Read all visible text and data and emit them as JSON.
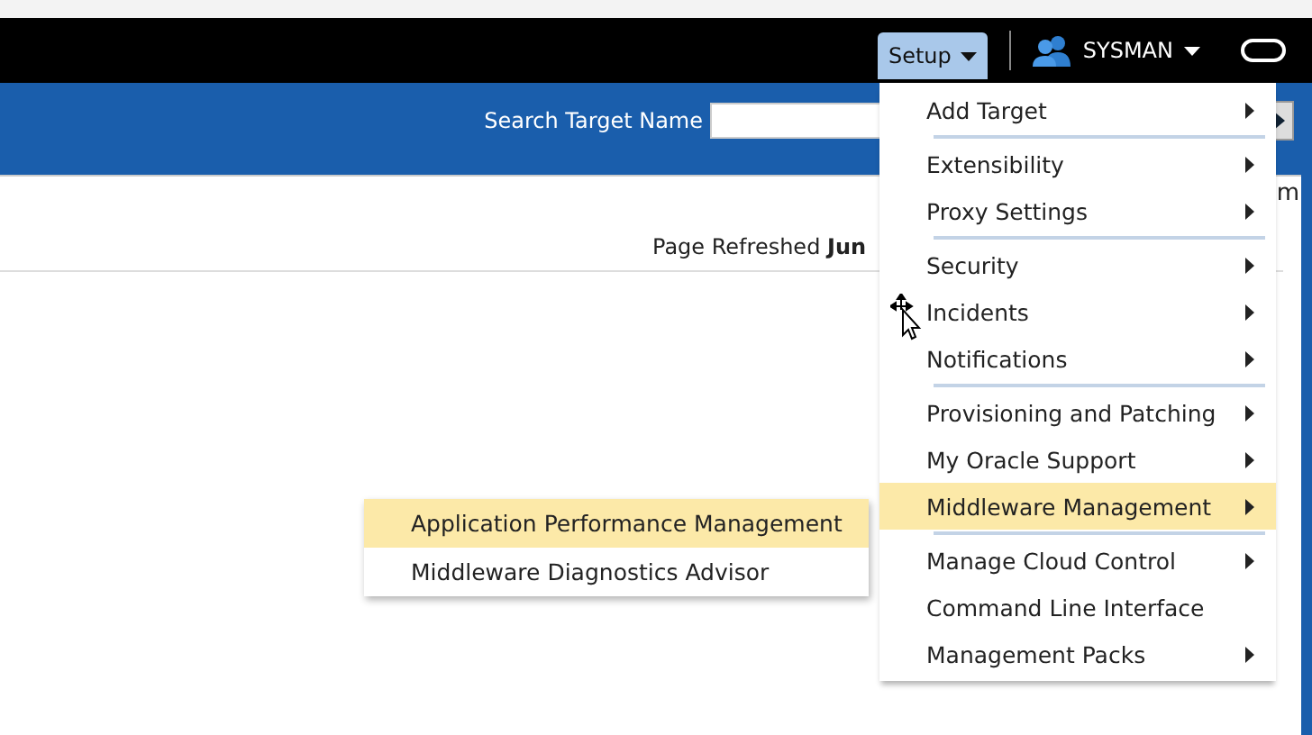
{
  "header": {
    "setup_button": {
      "label": "Setup",
      "expanded": true
    },
    "user_menu": {
      "label": "SYSMAN"
    }
  },
  "search": {
    "label": "Search Target Name"
  },
  "page": {
    "refreshed_label": "Page Refreshed",
    "refreshed_value": "Jun",
    "fragment": "m"
  },
  "setup_menu": {
    "groups": [
      [
        {
          "label": "Add Target",
          "submenu": true,
          "selected": false
        }
      ],
      [
        {
          "label": "Extensibility",
          "submenu": true,
          "selected": false
        },
        {
          "label": "Proxy Settings",
          "submenu": true,
          "selected": false
        }
      ],
      [
        {
          "label": "Security",
          "submenu": true,
          "selected": false
        },
        {
          "label": "Incidents",
          "submenu": true,
          "selected": false
        },
        {
          "label": "Notifications",
          "submenu": true,
          "selected": false
        }
      ],
      [
        {
          "label": "Provisioning and Patching",
          "submenu": true,
          "selected": false
        },
        {
          "label": "My Oracle Support",
          "submenu": true,
          "selected": false
        },
        {
          "label": "Middleware Management",
          "submenu": true,
          "selected": true
        }
      ],
      [
        {
          "label": "Manage Cloud Control",
          "submenu": true,
          "selected": false
        },
        {
          "label": "Command Line Interface",
          "submenu": false,
          "selected": false
        },
        {
          "label": "Management Packs",
          "submenu": true,
          "selected": false
        }
      ]
    ]
  },
  "submenu": {
    "items": [
      {
        "label": "Application Performance Management",
        "selected": true
      },
      {
        "label": "Middleware Diagnostics Advisor",
        "selected": false
      }
    ]
  }
}
